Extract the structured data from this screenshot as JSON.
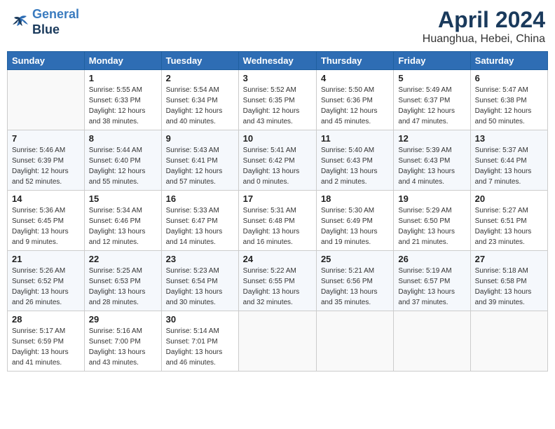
{
  "header": {
    "logo_line1": "General",
    "logo_line2": "Blue",
    "month": "April 2024",
    "location": "Huanghua, Hebei, China"
  },
  "weekdays": [
    "Sunday",
    "Monday",
    "Tuesday",
    "Wednesday",
    "Thursday",
    "Friday",
    "Saturday"
  ],
  "weeks": [
    [
      {
        "day": "",
        "info": ""
      },
      {
        "day": "1",
        "info": "Sunrise: 5:55 AM\nSunset: 6:33 PM\nDaylight: 12 hours\nand 38 minutes."
      },
      {
        "day": "2",
        "info": "Sunrise: 5:54 AM\nSunset: 6:34 PM\nDaylight: 12 hours\nand 40 minutes."
      },
      {
        "day": "3",
        "info": "Sunrise: 5:52 AM\nSunset: 6:35 PM\nDaylight: 12 hours\nand 43 minutes."
      },
      {
        "day": "4",
        "info": "Sunrise: 5:50 AM\nSunset: 6:36 PM\nDaylight: 12 hours\nand 45 minutes."
      },
      {
        "day": "5",
        "info": "Sunrise: 5:49 AM\nSunset: 6:37 PM\nDaylight: 12 hours\nand 47 minutes."
      },
      {
        "day": "6",
        "info": "Sunrise: 5:47 AM\nSunset: 6:38 PM\nDaylight: 12 hours\nand 50 minutes."
      }
    ],
    [
      {
        "day": "7",
        "info": "Sunrise: 5:46 AM\nSunset: 6:39 PM\nDaylight: 12 hours\nand 52 minutes."
      },
      {
        "day": "8",
        "info": "Sunrise: 5:44 AM\nSunset: 6:40 PM\nDaylight: 12 hours\nand 55 minutes."
      },
      {
        "day": "9",
        "info": "Sunrise: 5:43 AM\nSunset: 6:41 PM\nDaylight: 12 hours\nand 57 minutes."
      },
      {
        "day": "10",
        "info": "Sunrise: 5:41 AM\nSunset: 6:42 PM\nDaylight: 13 hours\nand 0 minutes."
      },
      {
        "day": "11",
        "info": "Sunrise: 5:40 AM\nSunset: 6:43 PM\nDaylight: 13 hours\nand 2 minutes."
      },
      {
        "day": "12",
        "info": "Sunrise: 5:39 AM\nSunset: 6:43 PM\nDaylight: 13 hours\nand 4 minutes."
      },
      {
        "day": "13",
        "info": "Sunrise: 5:37 AM\nSunset: 6:44 PM\nDaylight: 13 hours\nand 7 minutes."
      }
    ],
    [
      {
        "day": "14",
        "info": "Sunrise: 5:36 AM\nSunset: 6:45 PM\nDaylight: 13 hours\nand 9 minutes."
      },
      {
        "day": "15",
        "info": "Sunrise: 5:34 AM\nSunset: 6:46 PM\nDaylight: 13 hours\nand 12 minutes."
      },
      {
        "day": "16",
        "info": "Sunrise: 5:33 AM\nSunset: 6:47 PM\nDaylight: 13 hours\nand 14 minutes."
      },
      {
        "day": "17",
        "info": "Sunrise: 5:31 AM\nSunset: 6:48 PM\nDaylight: 13 hours\nand 16 minutes."
      },
      {
        "day": "18",
        "info": "Sunrise: 5:30 AM\nSunset: 6:49 PM\nDaylight: 13 hours\nand 19 minutes."
      },
      {
        "day": "19",
        "info": "Sunrise: 5:29 AM\nSunset: 6:50 PM\nDaylight: 13 hours\nand 21 minutes."
      },
      {
        "day": "20",
        "info": "Sunrise: 5:27 AM\nSunset: 6:51 PM\nDaylight: 13 hours\nand 23 minutes."
      }
    ],
    [
      {
        "day": "21",
        "info": "Sunrise: 5:26 AM\nSunset: 6:52 PM\nDaylight: 13 hours\nand 26 minutes."
      },
      {
        "day": "22",
        "info": "Sunrise: 5:25 AM\nSunset: 6:53 PM\nDaylight: 13 hours\nand 28 minutes."
      },
      {
        "day": "23",
        "info": "Sunrise: 5:23 AM\nSunset: 6:54 PM\nDaylight: 13 hours\nand 30 minutes."
      },
      {
        "day": "24",
        "info": "Sunrise: 5:22 AM\nSunset: 6:55 PM\nDaylight: 13 hours\nand 32 minutes."
      },
      {
        "day": "25",
        "info": "Sunrise: 5:21 AM\nSunset: 6:56 PM\nDaylight: 13 hours\nand 35 minutes."
      },
      {
        "day": "26",
        "info": "Sunrise: 5:19 AM\nSunset: 6:57 PM\nDaylight: 13 hours\nand 37 minutes."
      },
      {
        "day": "27",
        "info": "Sunrise: 5:18 AM\nSunset: 6:58 PM\nDaylight: 13 hours\nand 39 minutes."
      }
    ],
    [
      {
        "day": "28",
        "info": "Sunrise: 5:17 AM\nSunset: 6:59 PM\nDaylight: 13 hours\nand 41 minutes."
      },
      {
        "day": "29",
        "info": "Sunrise: 5:16 AM\nSunset: 7:00 PM\nDaylight: 13 hours\nand 43 minutes."
      },
      {
        "day": "30",
        "info": "Sunrise: 5:14 AM\nSunset: 7:01 PM\nDaylight: 13 hours\nand 46 minutes."
      },
      {
        "day": "",
        "info": ""
      },
      {
        "day": "",
        "info": ""
      },
      {
        "day": "",
        "info": ""
      },
      {
        "day": "",
        "info": ""
      }
    ]
  ]
}
